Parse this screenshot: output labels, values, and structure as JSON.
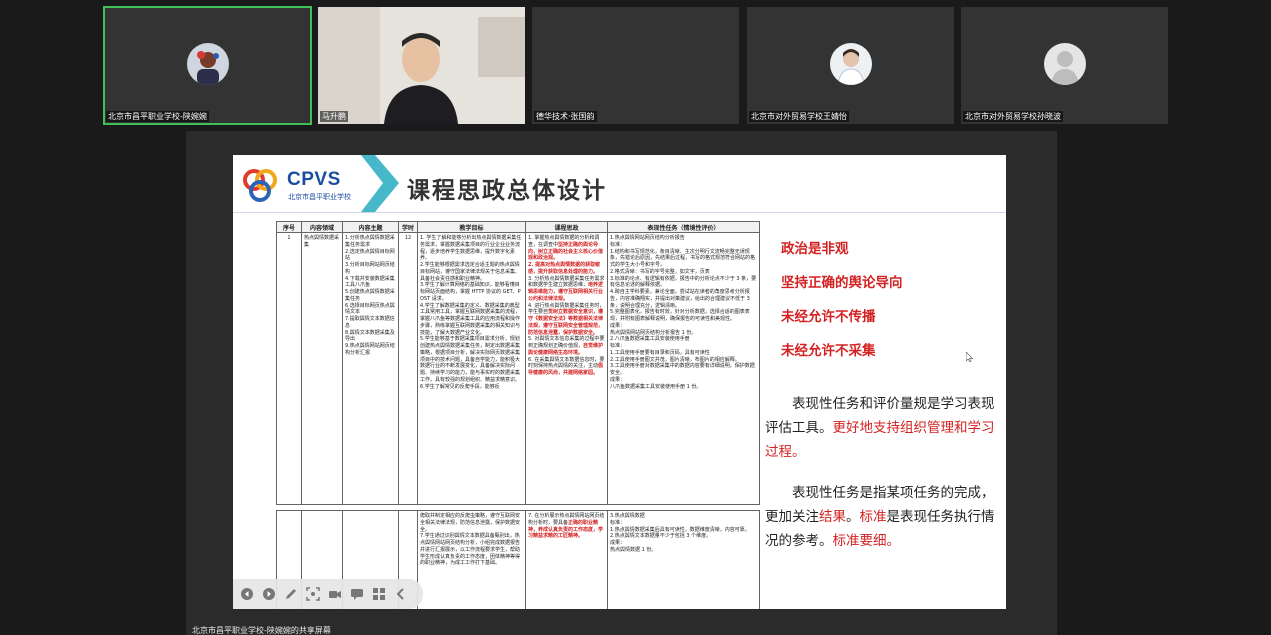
{
  "participants": [
    {
      "name": "北京市昌平职业学校-陕婉婉",
      "active": true
    },
    {
      "name": "马升鹏",
      "active": false
    },
    {
      "name": "德华技术·张国韵",
      "active": false
    },
    {
      "name": "北京市对外贸易学校王婧怡",
      "active": false
    },
    {
      "name": "北京市对外贸易学校孙晓波",
      "active": false
    }
  ],
  "slide": {
    "brand": "CPVS",
    "brand_sub": "北京市昌平职业学校",
    "title": "课程思政总体设计",
    "table": {
      "headers": [
        "序号",
        "内容领域",
        "内容主题",
        "学时",
        "教学目标",
        "课程思政",
        "表现性任务（情境性评价）"
      ],
      "row1": {
        "no": "1",
        "domain": "热点舆情数据采集",
        "topics": "1.分析热点舆情数据采集任务需求\n2.选定热点舆情目标网站\n3.分析目标网站网页结构\n4.下载并安装数据采集工具八爪鱼\n5.创建热点舆情数据采集任务\n6.选择目标网页热点舆情文本\n7.提取舆情文本数据信息\n8.舆情文本数据采集及导出\n9.热点舆情网站网页结构分析汇报",
        "hours": "12",
        "goals": "1. 学生了解和能够分析出热点舆情数据采集任务需求，掌握数据采集项目的行业企业业务流程，逐步培养学生数据思维，提升数字化素养。\n2.学生能够根据需求选定合适主题的热点舆情目标网站，遵守国家法律法规关于信息采集、具备社会责任感和职业精神。\n3.学生了解计算网络的基础知识，能够看懂目标网站页面结构，掌握 HTTP 协议的 GET、POST 请求。\n4.学生了解数据采集的定义、数据采集的典型工具常用工具，掌握互联网数据采集的流程，掌握八爪鱼等数据采集工具的应用流程和操作步骤，熟练掌握互联网数据采集的相关知识与技能，了解大数据产业文化。\n5.学生能够基于数据采集项目需求分析，规划创建热点舆情数据采集任务，制定出数据采集策略，根据项目分析，解决实际网页数据采集项目中的技术问题，具备自学能力，能积极大数据行业的不断发展变化，具备解决实际问题、持续学习的能力，能与事实时的数据采集工作，具有较强的规划组织、精益求精意识。\n6.学生了解常见的反爬手段，能够反",
        "ideology_plain1": "1. 掌握热点舆情数据的分析和调查，在调查中",
        "ideology_red1": "坚持正确的舆论导向，树立正确的社会主义核心价值观和政治观。",
        "ideology_red2": "2. 提高对热点舆情数据的获取敏感，提升获取信息处理的能力。",
        "ideology_plain2": "3. 分析热点舆情数据采集任务需求和数据学生建立数据思维，",
        "ideology_red3": "培养逻辑思维能力，遵守互联网相关行业公约和法律法规。",
        "ideology_plain3": "4. 进行热点舆情数据采集任务时，学生要自",
        "ideology_red4": "觉树立数据安全意识，遵守《数据安全法》等数据相关法律法规，遵守互联网安全管理规范，防范信息泄露，保护数据安全。",
        "ideology_plain4": "5. 对舆情文本信息采集的过程中要到正确规划正确价值观，",
        "ideology_red5": "自觉维护舆论健康网络生态环境。",
        "ideology_plain5": "6. 在采集舆情文本数据信息时，要时刻保持热点舆情的关注，主动",
        "ideology_red6": "倡导健康的风尚，共建网络家园。",
        "task": "1.热点舆情网站网页结构分析报告\n标准：\n1.结构和书写规范化，条目清晰、主次分明行文流畅完整无误现象，先错论后原因，先结果后过程，书写的格式规范符合网站的格式的学生大小号和字号。\n2.格式清晰：书写的字号完整，如文字，页表\n3.标准的论点、有逻辑有依据，报告中的分析论点不少于 3 条，要有信息论述的解释依据。\n4.跨自主学科要素，兼论全面，尝试站在读者的角度思考分析报告，内容准确翔实，并提出对策建议，给出的合理建议不低于 3 条，说明合理充分，逻辑清晰。\n5.完整图表化，报告有时效，针对分析数据，选择合适的图表表现，并附有图表解释说明，确保报告的可读性和美观性。\n成果：\n热点舆情网站网页结构分析报告 1 份。\n2.八爪鱼数据采集工具安装使用手册\n标准：\n1.工具使用手册要有目录和页码，具有可读性\n2.工具使用手册图文并茂，图片清晰，布图片的相应解释。\n3.工具使用手册对数据采集中的数据内容要有详细说明，保护数据安全。\n成果：\n八爪鱼数据采集工具安装使用手册 1 份。"
      },
      "row2": {
        "goals": "爬取并制定相应的反爬虫策略，遵守互联网安全相关法律法规，防范信息泄露，保护数据安全。\n7.学生通过识别舆情文本数据具备甄别出，热点舆情网站网页结构分析，小组完成数据报告并进行汇报展示，以工作流程要求学生，帮助学生形成认真负责的工作态度，团体精神等得的职业精神，为成工工作打下基础。",
        "ideology_plain1": "7. 在分析展示热点舆情网站网页结构分析时，要具备",
        "ideology_red1": "正确的职业精神，养成认真负责的工作态度，学习精益求精的工匠精神。",
        "task": "3.热点舆情数据\n标准：\n1.热点舆情数据采集后具有可读性，数据维度清晰，内容可靠。\n2.热点舆情文本数据量不少于包括 3 个维度。\n成果：\n热点舆情数据 1 份。"
      }
    },
    "highlights": [
      "政治是非观",
      "坚持正确的舆论导向",
      "未经允许不传播",
      "未经允许不采集"
    ],
    "para1": {
      "plain1": "表现性任务和评价量规是学习表现评估工具。",
      "red1": "更好地支持组织管理和学习过程。"
    },
    "para2": {
      "plain1": "表现性任务是指某项任务的完成，更加关注",
      "red1": "结果",
      "plain2": "。",
      "red2": "标准",
      "plain3": "是表现任务执行情况的参考。",
      "red3": "标准要细。"
    }
  },
  "share_label": "北京市昌平职业学校-陕婉婉的共享屏幕",
  "colors": {
    "accent": "#d42222",
    "brand": "#1a4fa0",
    "speaker": "#3fbf5a"
  },
  "toolbar_icons": [
    "prev-icon",
    "next-icon",
    "pen-icon",
    "screenshot-icon",
    "camera-icon",
    "chat-icon",
    "grid-icon",
    "collapse-icon"
  ]
}
